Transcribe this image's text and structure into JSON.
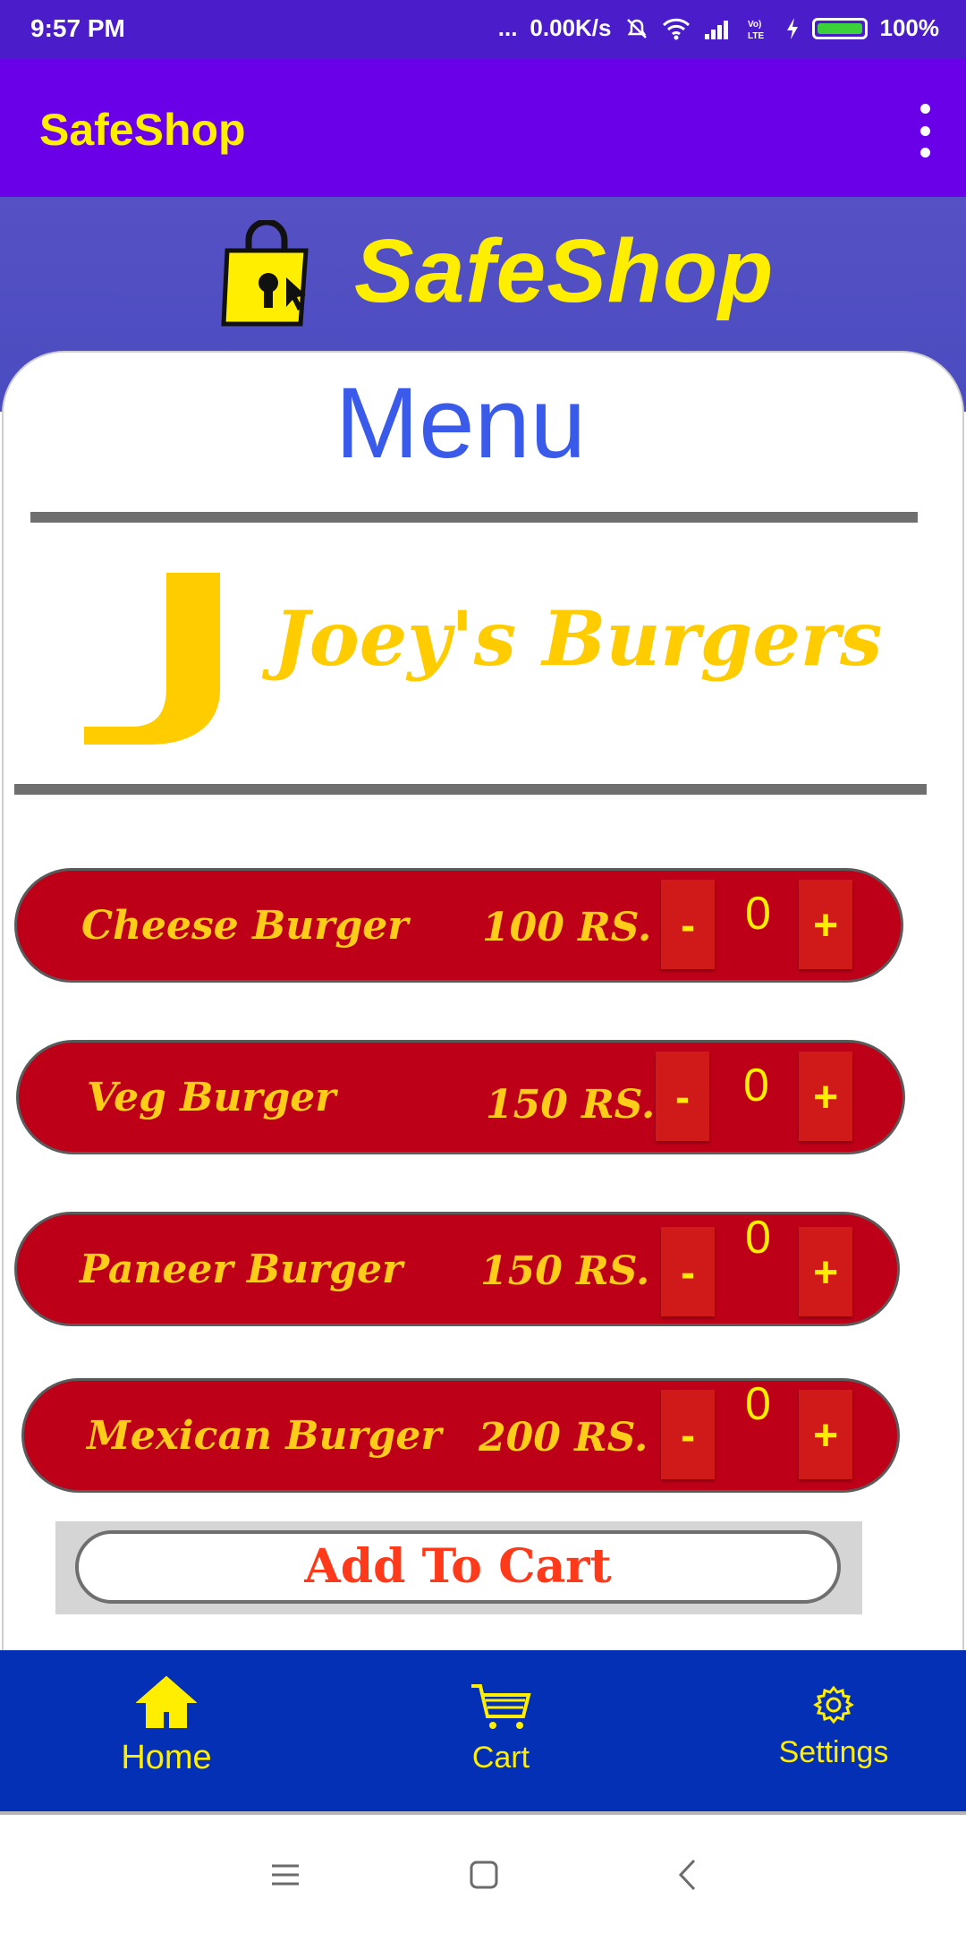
{
  "status_bar": {
    "time": "9:57 PM",
    "dots": "...",
    "speed": "0.00K/s",
    "battery": "100%",
    "icons": [
      "silent-icon",
      "wifi-icon",
      "signal-icon",
      "volte-icon",
      "charging-icon",
      "battery-icon"
    ]
  },
  "app_bar": {
    "title": "SafeShop",
    "menu_icon": "more-vert-icon"
  },
  "banner": {
    "logo_text": "SafeShop",
    "logo_icon": "shopping-bag-lock-icon"
  },
  "menu": {
    "title": "Menu",
    "restaurant_initial": "J",
    "restaurant_name": "Joey's Burgers",
    "items": [
      {
        "name": "Cheese Burger",
        "price": "100 RS.",
        "minus": "-",
        "qty": "0",
        "plus": "+"
      },
      {
        "name": "Veg Burger",
        "price": "150 RS.",
        "minus": "-",
        "qty": "0",
        "plus": "+"
      },
      {
        "name": "Paneer Burger",
        "price": "150 RS.",
        "minus": "-",
        "qty": "0",
        "plus": "+"
      },
      {
        "name": "Mexican Burger",
        "price": "200 RS.",
        "minus": "-",
        "qty": "0",
        "plus": "+"
      }
    ],
    "add_to_cart": "Add To Cart"
  },
  "bottom_nav": {
    "items": [
      {
        "label": "Home",
        "icon": "home-icon"
      },
      {
        "label": "Cart",
        "icon": "cart-icon"
      },
      {
        "label": "Settings",
        "icon": "settings-icon"
      }
    ]
  },
  "colors": {
    "status_bar": "#4b1cc9",
    "app_bar": "#6a00e8",
    "accent_yellow": "#ffee00",
    "item_red": "#bd0018",
    "bottom_nav": "#0430b5",
    "menu_title": "#3a5bea"
  }
}
